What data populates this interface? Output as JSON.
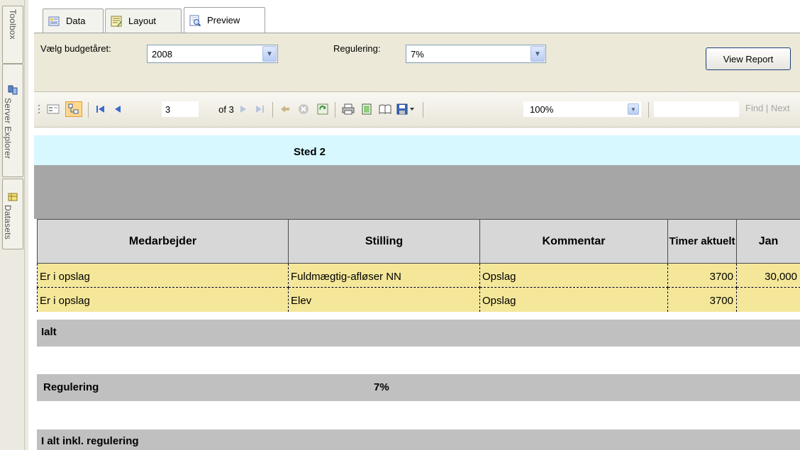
{
  "side_tabs": {
    "toolbox": "Toolbox",
    "server_explorer": "Server Explorer",
    "datasets": "Datasets"
  },
  "tabs": [
    {
      "label": "Data",
      "icon": "data-icon"
    },
    {
      "label": "Layout",
      "icon": "layout-icon"
    },
    {
      "label": "Preview",
      "icon": "preview-icon"
    }
  ],
  "params": {
    "budget_label": "Vælg budgetåret:",
    "budget_value": "2008",
    "regulering_label": "Regulering:",
    "regulering_value": "7%",
    "view_report": "View Report"
  },
  "toolbar": {
    "current_page": "3",
    "of_pages": "of 3",
    "zoom": "100%",
    "find": "Find",
    "next": "Next",
    "find_sep": "|"
  },
  "report": {
    "group_title": "Sted 2",
    "columns": [
      {
        "key": "medarbejder",
        "label": "Medarbejder"
      },
      {
        "key": "stilling",
        "label": "Stilling"
      },
      {
        "key": "kommentar",
        "label": "Kommentar"
      },
      {
        "key": "timer",
        "label": "Timer aktuelt"
      },
      {
        "key": "jan",
        "label": "Jan"
      }
    ],
    "rows": [
      {
        "medarbejder": "Er i opslag",
        "stilling": "Fuldmægtig-afløser NN",
        "kommentar": "Opslag",
        "timer": "3700",
        "jan": "30,000"
      },
      {
        "medarbejder": "Er i opslag",
        "stilling": "Elev",
        "kommentar": "Opslag",
        "timer": "3700",
        "jan": ""
      }
    ],
    "ialt_label": "Ialt",
    "regulering_label": "Regulering",
    "regulering_value": "7%",
    "ialt_inkl_label": "I alt inkl. regulering"
  },
  "colors": {
    "group_header_bg": "#d7f8ff",
    "row_bg": "#f4e799",
    "total_bg": "#c0c0c0",
    "band_bg": "#a6a6a6"
  }
}
